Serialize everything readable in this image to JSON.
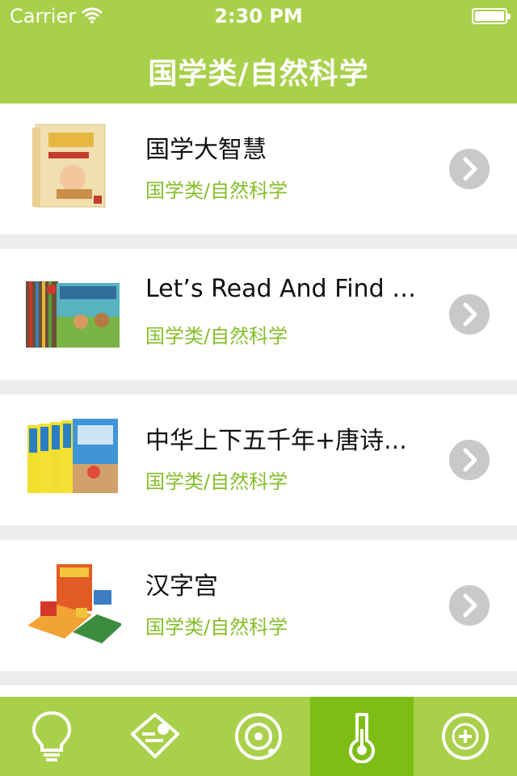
{
  "status_bar": {
    "carrier": "Carrier",
    "time": "2:30 PM"
  },
  "header": {
    "title": "国学类/自然科学"
  },
  "items": [
    {
      "name": "国学大智慧",
      "category": "国学类/自然科学"
    },
    {
      "name": "Let’s Read And Find O...",
      "category": "国学类/自然科学"
    },
    {
      "name": "中华上下五千年+唐诗...",
      "category": "国学类/自然科学"
    },
    {
      "name": "汉字宫",
      "category": "国学类/自然科学"
    }
  ],
  "tabbar": {
    "active_index": 3,
    "tabs": [
      {
        "icon": "lightbulb-icon"
      },
      {
        "icon": "reading-icon"
      },
      {
        "icon": "disc-icon"
      },
      {
        "icon": "thermometer-icon"
      },
      {
        "icon": "add-circle-icon"
      }
    ]
  },
  "colors": {
    "accent": "#a9d04a",
    "active_tab": "#7ebd14",
    "category_text": "#86be2a"
  }
}
